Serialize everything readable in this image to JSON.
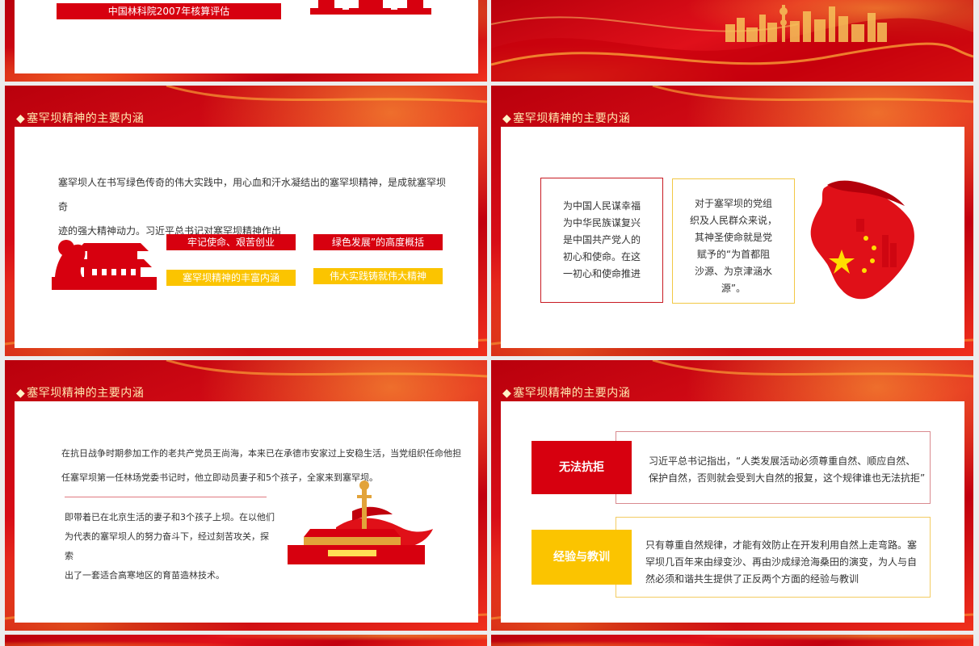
{
  "slide_top_left": {
    "caption": "中国林科院2007年核算评估"
  },
  "slide_left_1": {
    "title": "塞罕坝精神的主要内涵",
    "paragraph_line1": "塞罕坝人在书写绿色传奇的伟大实践中，用心血和汗水凝结出的塞罕坝精神，是成就塞罕坝奇",
    "paragraph_line2": "迹的强大精神动力。习近平总书记对塞罕坝精神作出",
    "tags": [
      "牢记使命、艰苦创业",
      "绿色发展”的高度概括",
      "塞罕坝精神的丰富内涵",
      "伟大实践铸就伟大精神"
    ]
  },
  "slide_right_1": {
    "title": "塞罕坝精神的主要内涵",
    "box_red_lines": [
      "为中国人民谋幸福",
      "为中华民族谋复兴",
      "是中国共产党人的",
      "初心和使命。在这",
      "一初心和使命推进"
    ],
    "box_yellow_lines": [
      "对于塞罕坝的党组",
      "织及人民群众来说，",
      "其神圣使命就是党",
      "赋予的“为首都阻",
      "沙源、为京津涵水",
      "源”。"
    ]
  },
  "slide_left_2": {
    "title": "塞罕坝精神的主要内涵",
    "para1_line1": "在抗日战争时期参加工作的老共产党员王尚海，本来已在承德市安家过上安稳生活，当党组织任命他担",
    "para1_line2": "任塞罕坝第一任林场党委书记时，他立即动员妻子和5个孩子，全家来到塞罕坝。",
    "para2_lines": [
      "即带着已在北京生活的妻子和3个孩子上坝。在以他们",
      "为代表的塞罕坝人的努力奋斗下，经过刻苦攻关，探索",
      "出了一套适合高寒地区的育苗造林技术。"
    ]
  },
  "slide_right_2": {
    "title": "塞罕坝精神的主要内涵",
    "label1": "无法抗拒",
    "text1_lines": [
      "习近平总书记指出，“人类发展活动必须尊重自然、顺应自然、",
      "保护自然，否则就会受到大自然的报复，这个规律谁也无法抗拒”"
    ],
    "label2": "经验与教训",
    "text2_lines": [
      "只有尊重自然规律，才能有效防止在开发利用自然上走弯路。塞",
      "罕坝几百年来由绿变沙、再由沙成绿沧海桑田的演变，为人与自",
      "然必须和谐共生提供了正反两个方面的经验与教训"
    ]
  },
  "colors": {
    "brand_red": "#d7000f",
    "brand_yellow": "#fbc400",
    "title_gold": "#ffe9b0"
  }
}
